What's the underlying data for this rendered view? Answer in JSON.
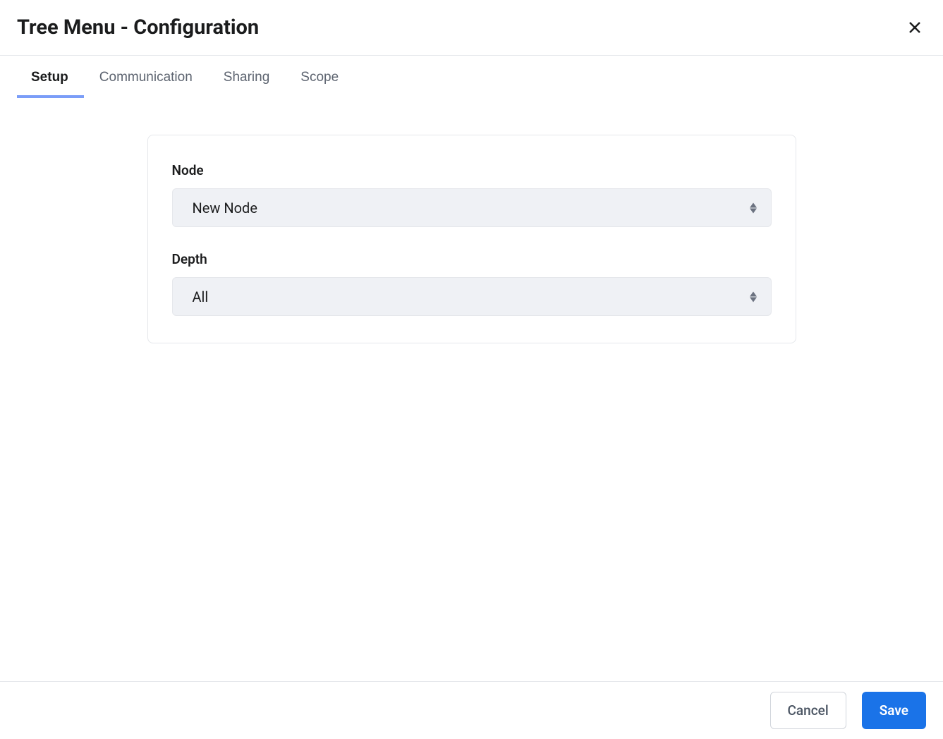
{
  "header": {
    "title": "Tree Menu - Configuration"
  },
  "tabs": [
    {
      "label": "Setup",
      "active": true
    },
    {
      "label": "Communication",
      "active": false
    },
    {
      "label": "Sharing",
      "active": false
    },
    {
      "label": "Scope",
      "active": false
    }
  ],
  "form": {
    "node": {
      "label": "Node",
      "value": "New Node"
    },
    "depth": {
      "label": "Depth",
      "value": "All"
    }
  },
  "footer": {
    "cancel": "Cancel",
    "save": "Save"
  }
}
